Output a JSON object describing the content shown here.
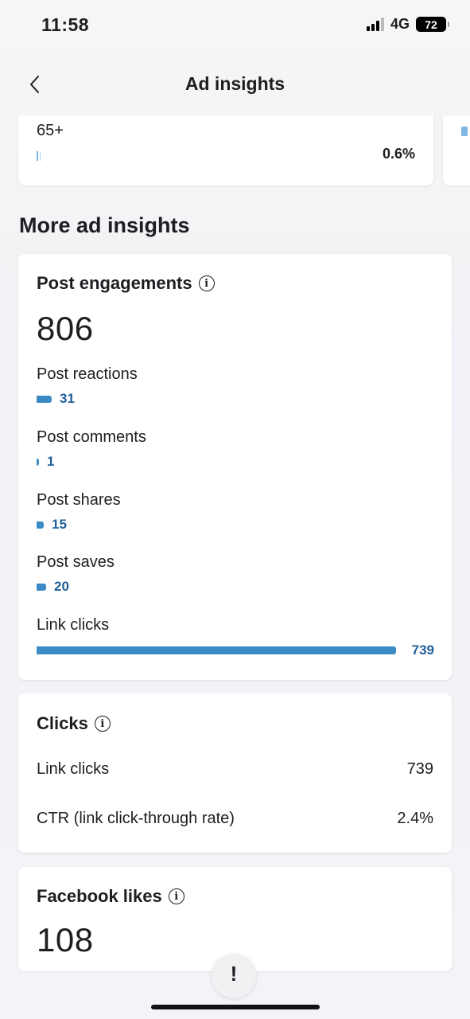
{
  "status_bar": {
    "time": "11:58",
    "network": "4G",
    "battery": "72"
  },
  "nav": {
    "title": "Ad insights",
    "back_icon": "chevron-left-icon"
  },
  "age_card": {
    "label": "65+",
    "value": "0.6%"
  },
  "section_title": "More ad insights",
  "post_engagements": {
    "title": "Post engagements",
    "total": "806",
    "metrics": [
      {
        "label": "Post reactions",
        "value": "31"
      },
      {
        "label": "Post comments",
        "value": "1"
      },
      {
        "label": "Post shares",
        "value": "15"
      },
      {
        "label": "Post saves",
        "value": "20"
      },
      {
        "label": "Link clicks",
        "value": "739"
      }
    ]
  },
  "clicks": {
    "title": "Clicks",
    "rows": [
      {
        "label": "Link clicks",
        "value": "739"
      },
      {
        "label": "CTR (link click-through rate)",
        "value": "2.4%"
      }
    ]
  },
  "facebook_likes": {
    "title": "Facebook likes",
    "total": "108"
  },
  "feedback": {
    "label": "!"
  },
  "colors": {
    "bar": "#3b8ac5",
    "value_text": "#1f5f98"
  }
}
